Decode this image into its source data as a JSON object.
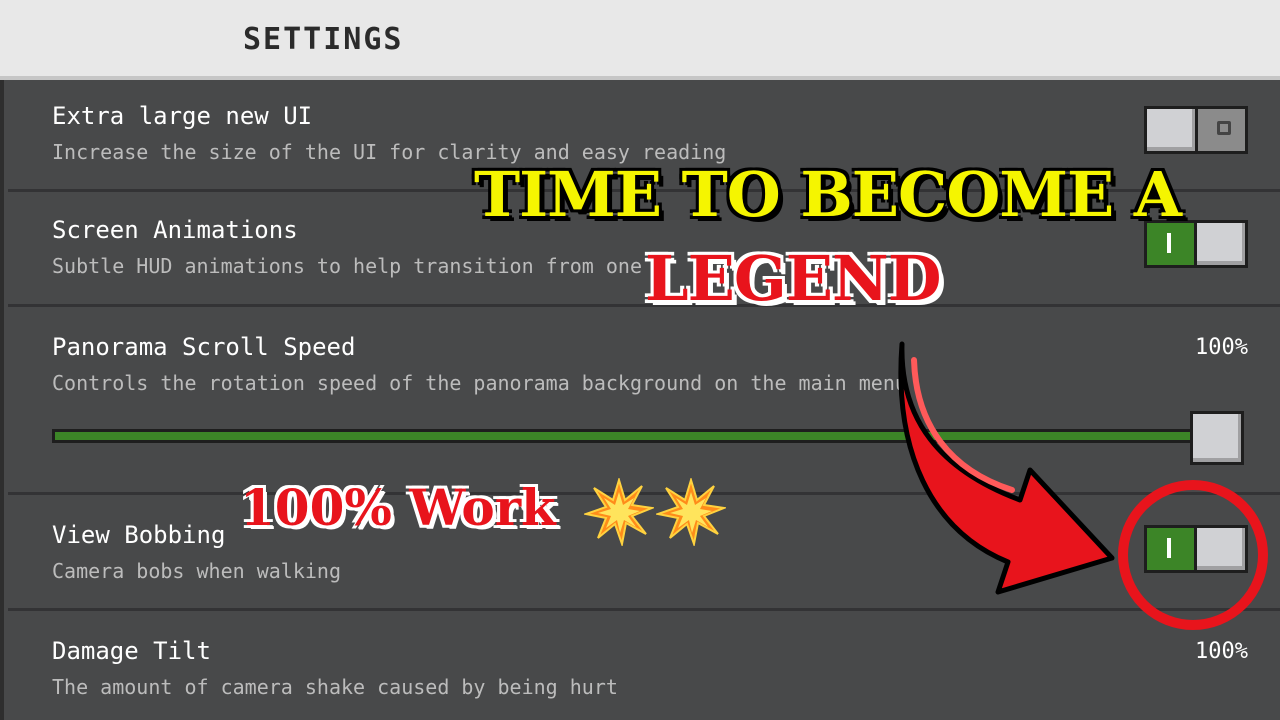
{
  "header": {
    "title": "SETTINGS"
  },
  "settings": [
    {
      "title": "Extra large new UI",
      "desc": "Increase the size of the UI for clarity and easy reading",
      "control": "toggle",
      "on": false
    },
    {
      "title": "Screen Animations",
      "desc": "Subtle HUD animations to help transition from one",
      "control": "toggle",
      "on": true
    },
    {
      "title": "Panorama Scroll Speed",
      "desc": "Controls the rotation speed of the panorama background on the main menu",
      "control": "slider",
      "value_text": "100%",
      "value": 100
    },
    {
      "title": "View Bobbing",
      "desc": "Camera bobs when walking",
      "control": "toggle",
      "on": true
    },
    {
      "title": "Damage Tilt",
      "desc": "The amount of camera shake caused by being hurt",
      "control": "slider",
      "value_text": "100%",
      "value": 100
    }
  ],
  "toggle_marks": {
    "on": "I",
    "off": "O"
  },
  "overlay": {
    "headline_1": "TIME TO BECOME A",
    "headline_2": "LEGEND",
    "work_text": "100% Work",
    "emoji": [
      "💥",
      "💥"
    ],
    "icons": [
      "collision-icon",
      "curved-arrow-icon",
      "highlight-circle"
    ]
  },
  "colors": {
    "header_bg": "#e8e8e8",
    "panel_bg": "#48494a",
    "toggle_on": "#3c8527",
    "knob": "#d0d1d4",
    "headline_yellow": "#f5f500",
    "headline_red": "#e8141c"
  }
}
